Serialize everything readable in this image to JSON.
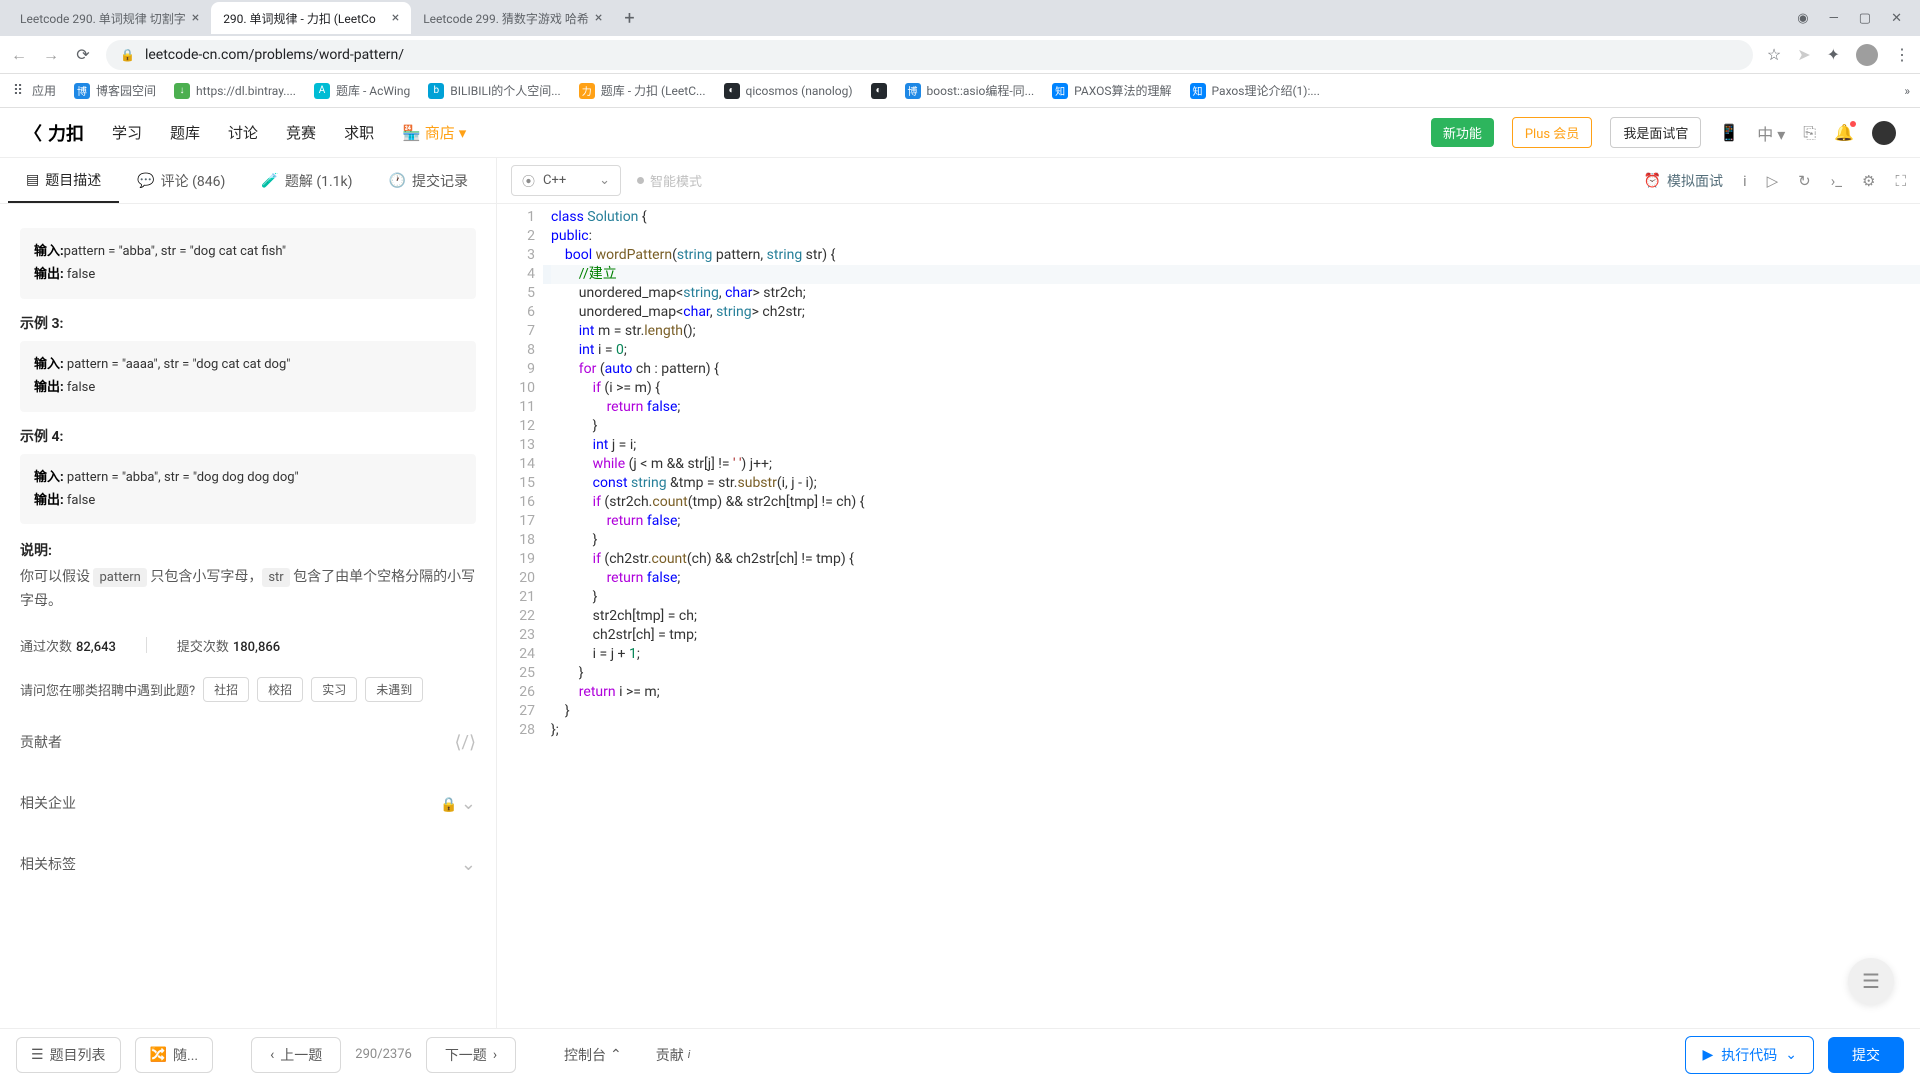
{
  "browser": {
    "tabs": [
      {
        "title": "Leetcode 290. 单词规律 切割字",
        "active": false
      },
      {
        "title": "290. 单词规律 - 力扣 (LeetCo",
        "active": true
      },
      {
        "title": "Leetcode 299. 猜数字游戏 哈希",
        "active": false
      }
    ],
    "url": "leetcode-cn.com/problems/word-pattern/"
  },
  "bookmarks": [
    {
      "label": "应用",
      "icon_bg": "#5f6368"
    },
    {
      "label": "博客园空间",
      "icon_bg": "#1e88e5"
    },
    {
      "label": "https://dl.bintray....",
      "icon_bg": "#4caf50"
    },
    {
      "label": "题库 - AcWing",
      "icon_bg": "#00bcd4"
    },
    {
      "label": "BILIBILI的个人空间...",
      "icon_bg": "#00a1d6"
    },
    {
      "label": "题库 - 力扣 (LeetC...",
      "icon_bg": "#ffa116"
    },
    {
      "label": "qicosmos (nanolog)",
      "icon_bg": "#24292e"
    },
    {
      "label": "",
      "icon_bg": "#24292e"
    },
    {
      "label": "boost::asio编程-同...",
      "icon_bg": "#1e88e5"
    },
    {
      "label": "PAXOS算法的理解",
      "icon_bg": "#0084ff"
    },
    {
      "label": "Paxos理论介绍(1):...",
      "icon_bg": "#0084ff"
    }
  ],
  "leetcode_header": {
    "logo": "力扣",
    "nav": [
      "学习",
      "题库",
      "讨论",
      "竞赛",
      "求职"
    ],
    "store": "商店",
    "new_feature": "新功能",
    "plus": "Plus 会员",
    "interviewer": "我是面试官",
    "lang_badge": "中"
  },
  "left_tabs": {
    "desc": "题目描述",
    "comments": "评论 (846)",
    "solutions": "题解 (1.1k)",
    "submissions": "提交记录"
  },
  "description": {
    "ex2": {
      "title": "",
      "in_label": "输入:",
      "in_val": "pattern = \"abba\", str = \"dog cat cat fish\"",
      "out_label": "输出:",
      "out_val": "false"
    },
    "ex3_title": "示例 3:",
    "ex3": {
      "in_label": "输入:",
      "in_val": "pattern = \"aaaa\", str = \"dog cat cat dog\"",
      "out_label": "输出:",
      "out_val": "false"
    },
    "ex4_title": "示例 4:",
    "ex4": {
      "in_label": "输入:",
      "in_val": "pattern = \"abba\", str = \"dog dog dog dog\"",
      "out_label": "输出:",
      "out_val": "false"
    },
    "note_title": "说明:",
    "note_text_1": "你可以假设 ",
    "note_code_1": "pattern",
    "note_text_2": " 只包含小写字母，",
    "note_code_2": "str",
    "note_text_3": " 包含了由单个空格分隔的小写字母。",
    "pass_label": "通过次数",
    "pass_num": "82,643",
    "submit_label": "提交次数",
    "submit_num": "180,866",
    "hiring_q": "请问您在哪类招聘中遇到此题?",
    "hiring_opts": [
      "社招",
      "校招",
      "实习",
      "未遇到"
    ],
    "contributor": "贡献者",
    "related_companies": "相关企业",
    "related_tags": "相关标签"
  },
  "editor_toolbar": {
    "language": "C++",
    "smart_mode": "智能模式",
    "mock_interview": "模拟面试"
  },
  "code_lines": [
    {
      "n": 1,
      "html": "<span class='kw'>class</span> <span class='type'>Solution</span> {"
    },
    {
      "n": 2,
      "html": "<span class='kw'>public</span>:"
    },
    {
      "n": 3,
      "html": "    <span class='kw'>bool</span> <span class='fn'>wordPattern</span>(<span class='type'>string</span> pattern, <span class='type'>string</span> str) {"
    },
    {
      "n": 4,
      "html": "        <span class='cmt'>//建立</span>",
      "hl": true
    },
    {
      "n": 5,
      "html": "        unordered_map&lt;<span class='type'>string</span>, <span class='kw'>char</span>&gt; str2ch;"
    },
    {
      "n": 6,
      "html": "        unordered_map&lt;<span class='kw'>char</span>, <span class='type'>string</span>&gt; ch2str;"
    },
    {
      "n": 7,
      "html": "        <span class='kw'>int</span> m = str.<span class='fn'>length</span>();"
    },
    {
      "n": 8,
      "html": "        <span class='kw'>int</span> i = <span class='num2'>0</span>;"
    },
    {
      "n": 9,
      "html": "        <span class='kw2'>for</span> (<span class='kw'>auto</span> ch : pattern) {"
    },
    {
      "n": 10,
      "html": "            <span class='kw2'>if</span> (i &gt;= m) {"
    },
    {
      "n": 11,
      "html": "                <span class='kw2'>return</span> <span class='kw'>false</span>;"
    },
    {
      "n": 12,
      "html": "            }"
    },
    {
      "n": 13,
      "html": "            <span class='kw'>int</span> j = i;"
    },
    {
      "n": 14,
      "html": "            <span class='kw2'>while</span> (j &lt; m &amp;&amp; str[j] != <span class='str'>' '</span>) j++;"
    },
    {
      "n": 15,
      "html": "            <span class='kw'>const</span> <span class='type'>string</span> &amp;tmp = str.<span class='fn'>substr</span>(i, j - i);"
    },
    {
      "n": 16,
      "html": "            <span class='kw2'>if</span> (str2ch.<span class='fn'>count</span>(tmp) &amp;&amp; str2ch[tmp] != ch) {"
    },
    {
      "n": 17,
      "html": "                <span class='kw2'>return</span> <span class='kw'>false</span>;"
    },
    {
      "n": 18,
      "html": "            }"
    },
    {
      "n": 19,
      "html": "            <span class='kw2'>if</span> (ch2str.<span class='fn'>count</span>(ch) &amp;&amp; ch2str[ch] != tmp) {"
    },
    {
      "n": 20,
      "html": "                <span class='kw2'>return</span> <span class='kw'>false</span>;"
    },
    {
      "n": 21,
      "html": "            }"
    },
    {
      "n": 22,
      "html": "            str2ch[tmp] = ch;"
    },
    {
      "n": 23,
      "html": "            ch2str[ch] = tmp;"
    },
    {
      "n": 24,
      "html": "            i = j + <span class='num2'>1</span>;"
    },
    {
      "n": 25,
      "html": "        }"
    },
    {
      "n": 26,
      "html": "        <span class='kw2'>return</span> i &gt;= m;"
    },
    {
      "n": 27,
      "html": "    }"
    },
    {
      "n": 28,
      "html": "};"
    }
  ],
  "bottom": {
    "list": "题目列表",
    "random": "随...",
    "prev": "上一题",
    "counter": "290/2376",
    "next": "下一题",
    "console": "控制台",
    "contribute": "贡献",
    "run": "执行代码",
    "submit": "提交"
  }
}
